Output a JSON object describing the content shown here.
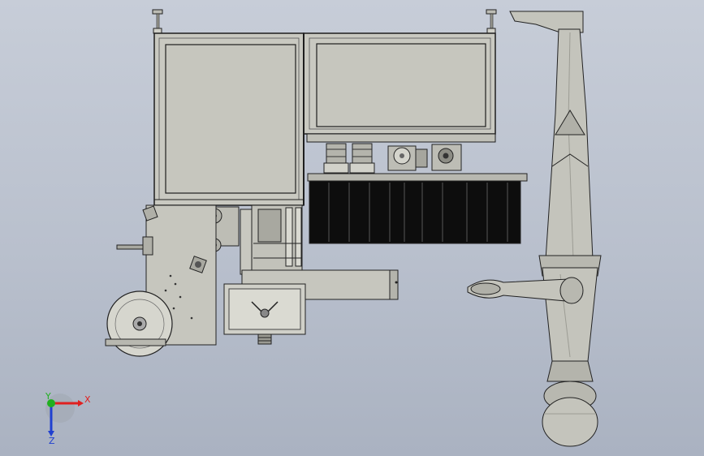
{
  "viewport": {
    "background_top": "#c7cdd8",
    "background_bottom": "#aab2c1"
  },
  "model": {
    "frame_color": "#c9c9c1",
    "frame_edge": "#1e1e1e",
    "steel_color": "#b8b8b0",
    "dark_panel_color": "#0d0d0d",
    "robot_color": "#c4c4bc",
    "robot_shadow": "#9c9c94"
  },
  "triad": {
    "x_label": "X",
    "y_label": "Y",
    "z_label": "Z",
    "x_color": "#e02020",
    "y_color": "#20b020",
    "z_color": "#2040d0",
    "glyph": "triad-icon"
  }
}
